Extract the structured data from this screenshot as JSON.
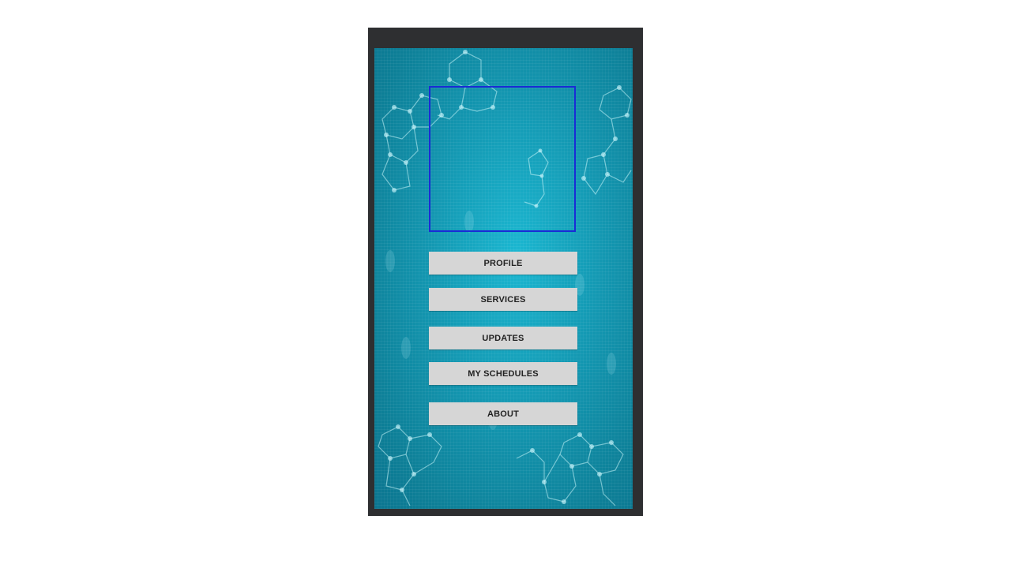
{
  "menu": {
    "profile_label": "PROFILE",
    "services_label": "SERVICES",
    "updates_label": "UPDATES",
    "schedules_label": "MY SCHEDULES",
    "about_label": "ABOUT"
  },
  "colors": {
    "frame": "#2e2f31",
    "background": "#1396b0",
    "image_border": "#1a2bd6",
    "button": "#d6d6d6",
    "button_text": "#222222"
  },
  "icons": {
    "background_pattern": "molecule-hexagon-pattern"
  }
}
